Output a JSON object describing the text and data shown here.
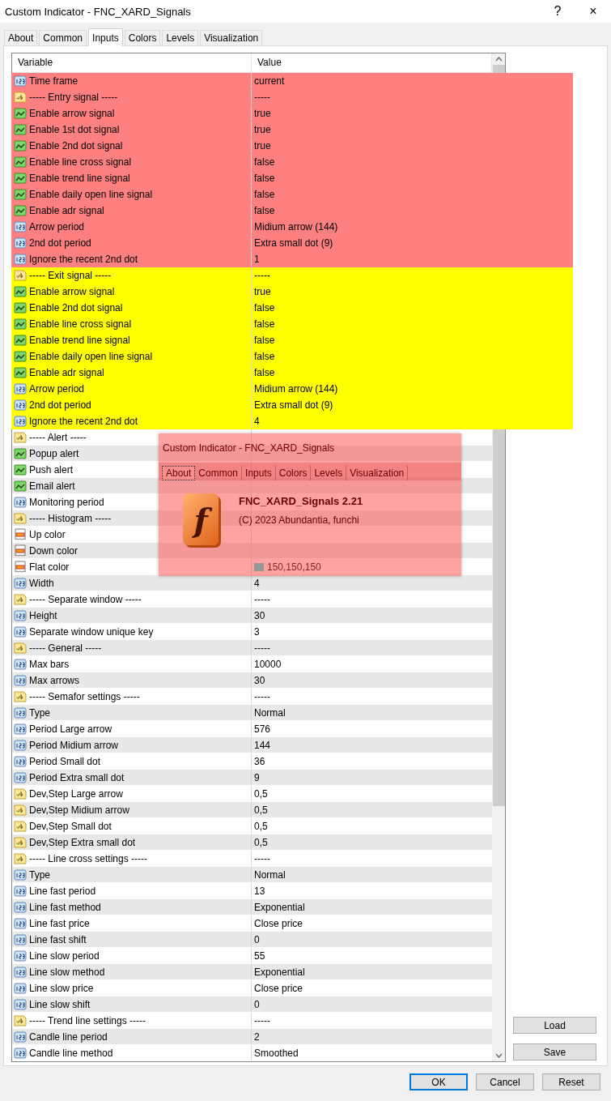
{
  "window": {
    "title": "Custom Indicator - FNC_XARD_Signals",
    "title_buttons": [
      "?",
      "×"
    ]
  },
  "tabs": [
    {
      "label": "About",
      "selected": false
    },
    {
      "label": "Common",
      "selected": false
    },
    {
      "label": "Inputs",
      "selected": true
    },
    {
      "label": "Colors",
      "selected": false
    },
    {
      "label": "Levels",
      "selected": false
    },
    {
      "label": "Visualization",
      "selected": false
    }
  ],
  "table": {
    "columns": [
      "Variable",
      "Value"
    ],
    "rows": [
      {
        "kind": "int",
        "variable": "Time frame",
        "value": "current",
        "color": "#ff8080"
      },
      {
        "kind": "string",
        "variable": "----- Entry signal -----",
        "value": "-----",
        "color": "#ff8080"
      },
      {
        "kind": "bool",
        "variable": "Enable arrow signal",
        "value": "true",
        "color": "#ff8080"
      },
      {
        "kind": "bool",
        "variable": "Enable 1st dot signal",
        "value": "true",
        "color": "#ff8080"
      },
      {
        "kind": "bool",
        "variable": "Enable 2nd dot signal",
        "value": "true",
        "color": "#ff8080"
      },
      {
        "kind": "bool",
        "variable": "Enable line cross signal",
        "value": "false",
        "color": "#ff8080"
      },
      {
        "kind": "bool",
        "variable": "Enable trend line signal",
        "value": "false",
        "color": "#ff8080"
      },
      {
        "kind": "bool",
        "variable": "Enable daily open line signal",
        "value": "false",
        "color": "#ff8080"
      },
      {
        "kind": "bool",
        "variable": "Enable adr signal",
        "value": "false",
        "color": "#ff8080"
      },
      {
        "kind": "int",
        "variable": "Arrow period",
        "value": "Midium arrow (144)",
        "color": "#ff8080"
      },
      {
        "kind": "int",
        "variable": "2nd dot period",
        "value": "Extra small dot (9)",
        "color": "#ff8080"
      },
      {
        "kind": "int",
        "variable": "Ignore the recent 2nd dot",
        "value": "1",
        "color": "#ff8080"
      },
      {
        "kind": "string",
        "variable": "----- Exit signal -----",
        "value": "-----",
        "color": "#ffff00"
      },
      {
        "kind": "bool",
        "variable": "Enable arrow signal",
        "value": "true",
        "color": "#ffff00"
      },
      {
        "kind": "bool",
        "variable": "Enable 2nd dot signal",
        "value": "false",
        "color": "#ffff00"
      },
      {
        "kind": "bool",
        "variable": "Enable line cross signal",
        "value": "false",
        "color": "#ffff00"
      },
      {
        "kind": "bool",
        "variable": "Enable trend line signal",
        "value": "false",
        "color": "#ffff00"
      },
      {
        "kind": "bool",
        "variable": "Enable daily open line signal",
        "value": "false",
        "color": "#ffff00"
      },
      {
        "kind": "bool",
        "variable": "Enable adr signal",
        "value": "false",
        "color": "#ffff00"
      },
      {
        "kind": "int",
        "variable": "Arrow period",
        "value": "Midium arrow (144)",
        "color": "#ffff00"
      },
      {
        "kind": "int",
        "variable": "2nd dot period",
        "value": "Extra small dot (9)",
        "color": "#ffff00"
      },
      {
        "kind": "int",
        "variable": "Ignore the recent 2nd dot",
        "value": "4",
        "color": "#ffff00"
      },
      {
        "kind": "string",
        "variable": "----- Alert -----"
      },
      {
        "kind": "bool",
        "variable": "Popup alert"
      },
      {
        "kind": "bool",
        "variable": "Push alert"
      },
      {
        "kind": "bool",
        "variable": "Email alert"
      },
      {
        "kind": "int",
        "variable": "Monitoring period"
      },
      {
        "kind": "string",
        "variable": "----- Histogram -----"
      },
      {
        "kind": "color",
        "variable": "Up color"
      },
      {
        "kind": "color",
        "variable": "Down color"
      },
      {
        "kind": "color",
        "variable": "Flat color",
        "value": "150,150,150",
        "swatch": {
          "color": "#969696"
        }
      },
      {
        "kind": "int",
        "variable": "Width",
        "value": "4"
      },
      {
        "kind": "string",
        "variable": "----- Separate window -----",
        "value": "-----"
      },
      {
        "kind": "int",
        "variable": "Height",
        "value": "30"
      },
      {
        "kind": "int",
        "variable": "Separate window unique key",
        "value": "3"
      },
      {
        "kind": "string",
        "variable": "----- General -----",
        "value": "-----"
      },
      {
        "kind": "int",
        "variable": "Max bars",
        "value": "10000"
      },
      {
        "kind": "int",
        "variable": "Max arrows",
        "value": "30"
      },
      {
        "kind": "string",
        "variable": "----- Semafor settings -----",
        "value": "-----"
      },
      {
        "kind": "int",
        "variable": "Type",
        "value": "Normal"
      },
      {
        "kind": "int",
        "variable": "Period Large arrow",
        "value": "576"
      },
      {
        "kind": "int",
        "variable": "Period Midium arrow",
        "value": "144"
      },
      {
        "kind": "int",
        "variable": "Period Small dot",
        "value": "36"
      },
      {
        "kind": "int",
        "variable": "Period Extra small dot",
        "value": "9"
      },
      {
        "kind": "string",
        "variable": "Dev,Step Large arrow",
        "value": "0,5"
      },
      {
        "kind": "string",
        "variable": "Dev,Step Midium arrow",
        "value": "0,5"
      },
      {
        "kind": "string",
        "variable": "Dev,Step Small dot",
        "value": "0,5"
      },
      {
        "kind": "string",
        "variable": "Dev,Step Extra small dot",
        "value": "0,5"
      },
      {
        "kind": "string",
        "variable": "----- Line cross settings -----",
        "value": "-----"
      },
      {
        "kind": "int",
        "variable": "Type",
        "value": "Normal"
      },
      {
        "kind": "int",
        "variable": "Line fast period",
        "value": "13"
      },
      {
        "kind": "int",
        "variable": "Line fast method",
        "value": "Exponential"
      },
      {
        "kind": "int",
        "variable": "Line fast price",
        "value": "Close price"
      },
      {
        "kind": "int",
        "variable": "Line fast shift",
        "value": "0"
      },
      {
        "kind": "int",
        "variable": "Line slow period",
        "value": "55"
      },
      {
        "kind": "int",
        "variable": "Line slow method",
        "value": "Exponential"
      },
      {
        "kind": "int",
        "variable": "Line slow price",
        "value": "Close price"
      },
      {
        "kind": "int",
        "variable": "Line slow shift",
        "value": "0"
      },
      {
        "kind": "string",
        "variable": "----- Trend line settings -----",
        "value": "-----"
      },
      {
        "kind": "int",
        "variable": "Candle line period",
        "value": "2"
      },
      {
        "kind": "int",
        "variable": "Candle line method",
        "value": "Smoothed"
      }
    ]
  },
  "side_buttons": [
    "Load",
    "Save"
  ],
  "buttons": [
    {
      "label": "OK",
      "default": true
    },
    {
      "label": "Cancel",
      "default": false
    },
    {
      "label": "Reset",
      "default": false
    }
  ],
  "popup": {
    "title": "Custom Indicator - FNC_XARD_Signals",
    "tabs": [
      {
        "label": "About",
        "selected": true
      },
      {
        "label": "Common",
        "selected": false
      },
      {
        "label": "Inputs",
        "selected": false
      },
      {
        "label": "Colors",
        "selected": false
      },
      {
        "label": "Levels",
        "selected": false
      },
      {
        "label": "Visualization",
        "selected": false
      }
    ],
    "logo_letter": "f",
    "name": "FNC_XARD_Signals 2.21",
    "copyright": "(C) 2023 Abundantia, funchi"
  }
}
